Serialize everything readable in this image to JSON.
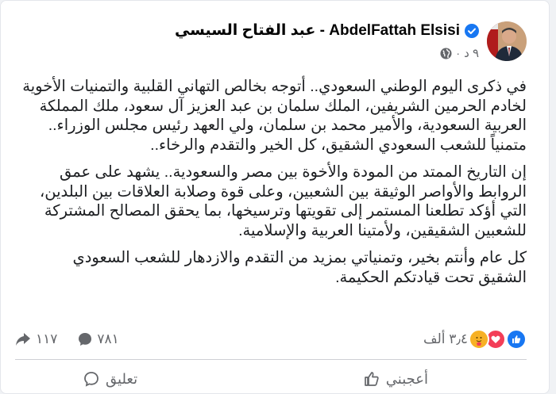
{
  "author": {
    "name": "عبد الفتاح السيسي - AbdelFattah Elsisi",
    "time": "٩ د",
    "verified_color": "#1877f2"
  },
  "post": {
    "paragraphs": [
      "في ذكرى اليوم الوطني السعودي.. أتوجه بخالص التهاني القلبية والتمنيات الأخوية لخادم الحرمين الشريفين، الملك سلمان بن عبد العزيز آل سعود، ملك المملكة العربية السعودية، والأمير محمد بن سلمان، ولي العهد رئيس مجلس الوزراء.. متمنياً للشعب السعودي الشقيق، كل الخير والتقدم والرخاء..",
      "إن التاريخ الممتد من المودة والأخوة بين مصر والسعودية.. يشهد على عمق الروابط والأواصر الوثيقة بين الشعبين، وعلى قوة وصلابة العلاقات بين البلدين، التي أؤكد تطلعنا المستمر إلى تقويتها وترسيخها، بما يحقق المصالح المشتركة للشعبين الشقيقين، ولأمتينا العربية والإسلامية.",
      "كل عام وأنتم بخير، وتمنياتي بمزيد من التقدم والازدهار للشعب السعودي الشقيق تحت قيادتكم الحكيمة."
    ]
  },
  "stats": {
    "reactions_count": "٣٫٤ ألف",
    "reaction_icons": [
      "like-icon",
      "love-icon",
      "care-icon"
    ],
    "comments_count": "٧٨١",
    "shares_count": "١١٧"
  },
  "actions": {
    "like_label": "أعجبني",
    "comment_label": "تعليق"
  }
}
